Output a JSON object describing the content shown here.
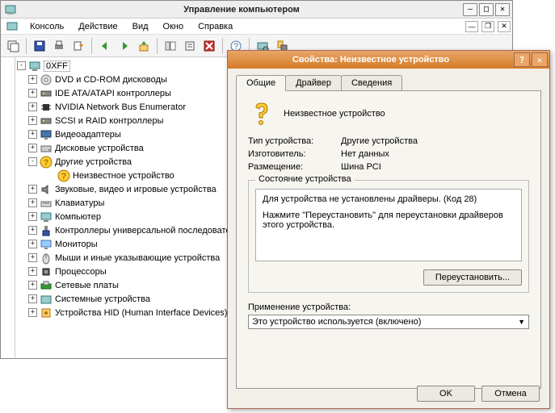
{
  "main_window": {
    "title": "Управление компьютером",
    "menubar": [
      "Консоль",
      "Действие",
      "Вид",
      "Окно",
      "Справка"
    ],
    "toolbar_icons": [
      "new-window-icon",
      "blank-icon",
      "save-icon",
      "nav-back-icon",
      "nav-fwd-icon",
      "up-icon",
      "view-icon",
      "cut-icon",
      "copy-icon",
      "paste-icon",
      "delete-icon",
      "properties-icon",
      "refresh-icon",
      "help-icon",
      "scan-icon",
      "config-icon"
    ]
  },
  "tree": {
    "root": "0XFF",
    "items": [
      {
        "toggle": "+",
        "icon": "disc-icon",
        "label": "DVD и CD-ROM дисководы"
      },
      {
        "toggle": "+",
        "icon": "controller-icon",
        "label": "IDE ATA/ATAPI контроллеры"
      },
      {
        "toggle": "+",
        "icon": "chip-icon",
        "label": "NVIDIA Network Bus Enumerator"
      },
      {
        "toggle": "+",
        "icon": "controller-icon",
        "label": "SCSI и RAID контроллеры"
      },
      {
        "toggle": "+",
        "icon": "display-icon",
        "label": "Видеоадаптеры"
      },
      {
        "toggle": "+",
        "icon": "disk-icon",
        "label": "Дисковые устройства"
      },
      {
        "toggle": "-",
        "icon": "question-icon",
        "label": "Другие устройства"
      },
      {
        "toggle": "+",
        "icon": "sound-icon",
        "label": "Звуковые, видео и игровые устройства"
      },
      {
        "toggle": "+",
        "icon": "keyboard-icon",
        "label": "Клавиатуры"
      },
      {
        "toggle": "+",
        "icon": "computer-icon",
        "label": "Компьютер"
      },
      {
        "toggle": "+",
        "icon": "usb-icon",
        "label": "Контроллеры универсальной последовате..."
      },
      {
        "toggle": "+",
        "icon": "monitor-icon",
        "label": "Мониторы"
      },
      {
        "toggle": "+",
        "icon": "mouse-icon",
        "label": "Мыши и иные указывающие устройства"
      },
      {
        "toggle": "+",
        "icon": "processor-icon",
        "label": "Процессоры"
      },
      {
        "toggle": "+",
        "icon": "network-icon",
        "label": "Сетевые платы"
      },
      {
        "toggle": "+",
        "icon": "system-icon",
        "label": "Системные устройства"
      },
      {
        "toggle": "+",
        "icon": "hid-icon",
        "label": "Устройства HID (Human Interface Devices)"
      }
    ],
    "child_of_other": {
      "icon": "question-yellow-icon",
      "label": "Неизвестное устройство"
    }
  },
  "dialog": {
    "title": "Свойства: Неизвестное устройство",
    "tabs": [
      "Общие",
      "Драйвер",
      "Сведения"
    ],
    "device_name": "Неизвестное устройство",
    "type_label": "Тип устройства:",
    "type_value": "Другие устройства",
    "mfr_label": "Изготовитель:",
    "mfr_value": "Нет данных",
    "loc_label": "Размещение:",
    "loc_value": "Шина PCI",
    "status_caption": "Состояние устройства",
    "status_line1": "Для устройства не установлены драйверы. (Код 28)",
    "status_line2": "Нажмите \"Переустановить\" для переустановки драйверов этого устройства.",
    "reinstall_btn": "Переустановить...",
    "usage_label": "Применение устройства:",
    "usage_value": "Это устройство используется (включено)",
    "ok": "OK",
    "cancel": "Отмена"
  }
}
